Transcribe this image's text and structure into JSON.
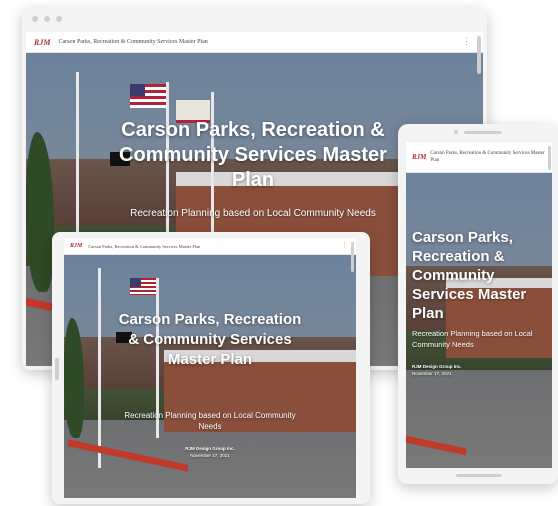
{
  "site": {
    "logo": "RJM",
    "title": "Carson Parks, Recreation & Community Services Master Plan"
  },
  "hero": {
    "title_desktop": "Carson Parks, Recreation & Community Services Master Plan",
    "subtitle": "Recreation Planning based on Local Community Needs",
    "author": "RJM Design Group Inc.",
    "date": "November 17, 2021"
  },
  "icons": {
    "menu": "dots-vertical-icon",
    "window_controls": "traffic-light-dots"
  },
  "colors": {
    "brand": "#b22b2b",
    "hero_text": "#ffffff"
  }
}
